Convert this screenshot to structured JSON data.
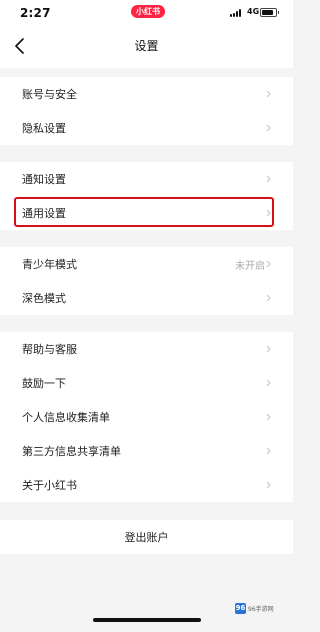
{
  "status_bar": {
    "time": "2:27",
    "app_badge": "小红书",
    "network": "4G",
    "battery_level": 0.85
  },
  "header": {
    "title": "设置",
    "back_icon": "chevron-left-icon"
  },
  "groups": [
    {
      "items": [
        {
          "label": "账号与安全"
        },
        {
          "label": "隐私设置"
        }
      ]
    },
    {
      "items": [
        {
          "label": "通知设置"
        },
        {
          "label": "通用设置",
          "highlighted": true
        }
      ]
    },
    {
      "items": [
        {
          "label": "青少年模式",
          "value": "未开启"
        },
        {
          "label": "深色模式"
        }
      ]
    },
    {
      "items": [
        {
          "label": "帮助与客服"
        },
        {
          "label": "鼓励一下"
        },
        {
          "label": "个人信息收集清单"
        },
        {
          "label": "第三方信息共享清单"
        },
        {
          "label": "关于小红书"
        }
      ]
    }
  ],
  "logout": {
    "label": "登出账户"
  },
  "watermark": {
    "text": "96手游网"
  },
  "colors": {
    "accent": "#ff2442",
    "highlight_border": "#d3121e",
    "background": "#f4f4f4"
  }
}
